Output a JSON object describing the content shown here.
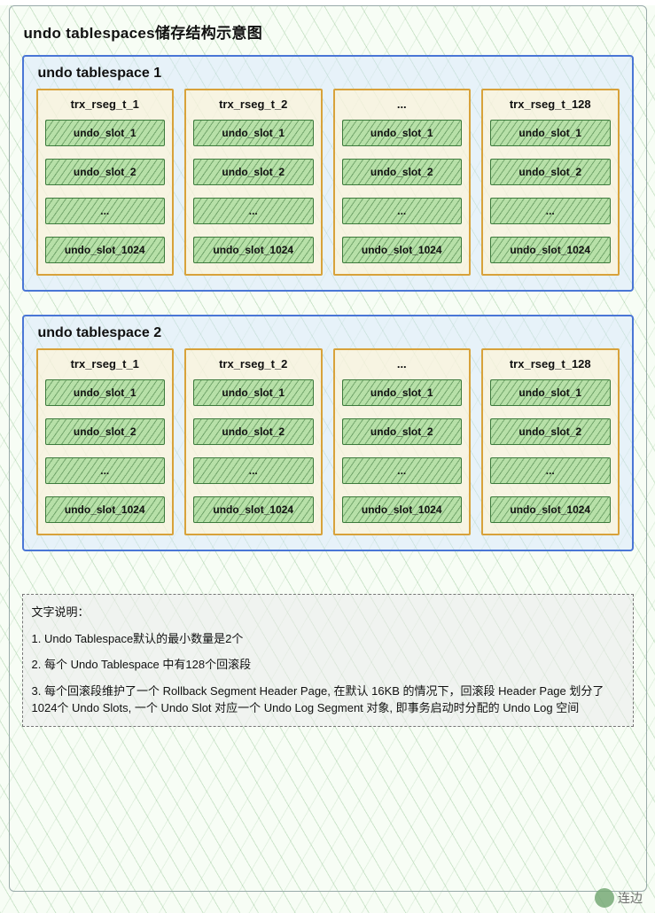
{
  "title": "undo tablespaces储存结构示意图",
  "tablespaces": [
    {
      "label": "undo tablespace 1",
      "rsegs": [
        {
          "label": "trx_rseg_t_1",
          "slots": [
            "undo_slot_1",
            "undo_slot_2",
            "...",
            "undo_slot_1024"
          ]
        },
        {
          "label": "trx_rseg_t_2",
          "slots": [
            "undo_slot_1",
            "undo_slot_2",
            "...",
            "undo_slot_1024"
          ]
        },
        {
          "label": "...",
          "slots": [
            "undo_slot_1",
            "undo_slot_2",
            "...",
            "undo_slot_1024"
          ]
        },
        {
          "label": "trx_rseg_t_128",
          "slots": [
            "undo_slot_1",
            "undo_slot_2",
            "...",
            "undo_slot_1024"
          ]
        }
      ]
    },
    {
      "label": "undo tablespace 2",
      "rsegs": [
        {
          "label": "trx_rseg_t_1",
          "slots": [
            "undo_slot_1",
            "undo_slot_2",
            "...",
            "undo_slot_1024"
          ]
        },
        {
          "label": "trx_rseg_t_2",
          "slots": [
            "undo_slot_1",
            "undo_slot_2",
            "...",
            "undo_slot_1024"
          ]
        },
        {
          "label": "...",
          "slots": [
            "undo_slot_1",
            "undo_slot_2",
            "...",
            "undo_slot_1024"
          ]
        },
        {
          "label": "trx_rseg_t_128",
          "slots": [
            "undo_slot_1",
            "undo_slot_2",
            "...",
            "undo_slot_1024"
          ]
        }
      ]
    }
  ],
  "notes": {
    "heading": "文字说明：",
    "items": [
      "1. Undo Tablespace默认的最小数量是2个",
      "2. 每个 Undo Tablespace 中有128个回滚段",
      "3. 每个回滚段维护了一个 Rollback Segment Header Page, 在默认 16KB 的情况下，回滚段 Header Page 划分了1024个 Undo Slots, 一个 Undo Slot 对应一个 Undo Log Segment 对象, 即事务启动时分配的 Undo Log 空间"
    ]
  },
  "watermark": "连边"
}
